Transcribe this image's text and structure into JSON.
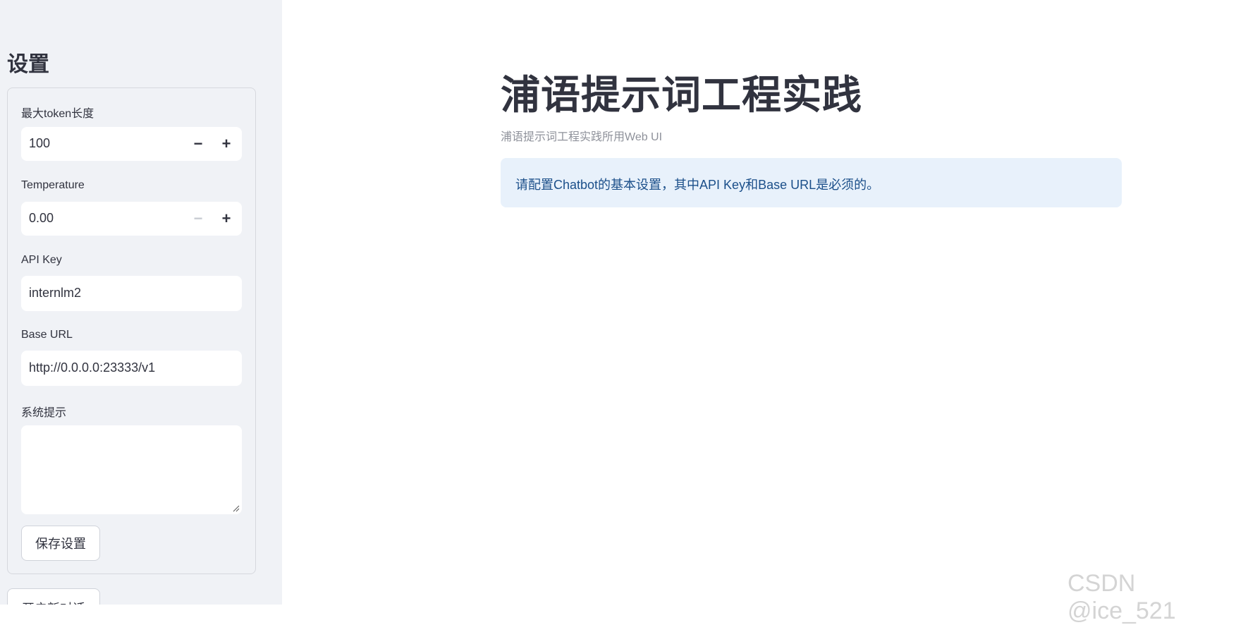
{
  "sidebar": {
    "title": "设置",
    "max_tokens": {
      "label": "最大token长度",
      "value": "100",
      "minus_icon": "minus-icon",
      "plus_icon": "plus-icon"
    },
    "temperature": {
      "label": "Temperature",
      "value": "0.00",
      "minus_icon": "minus-icon",
      "plus_icon": "plus-icon"
    },
    "api_key": {
      "label": "API Key",
      "value": "internlm2"
    },
    "base_url": {
      "label": "Base URL",
      "value": "http://0.0.0.0:23333/v1"
    },
    "system_prompt": {
      "label": "系统提示",
      "value": ""
    },
    "save_label": "保存设置",
    "new_chat_label": "开启新对话"
  },
  "main": {
    "title": "浦语提示词工程实践",
    "subtitle": "浦语提示词工程实践所用Web UI",
    "info_message": "请配置Chatbot的基本设置，其中API Key和Base URL是必须的。"
  },
  "watermark": "CSDN @ice_521",
  "colors": {
    "sidebar_bg": "#f0f2f6",
    "info_bg": "#e8f1fb",
    "info_text": "#1b4f8a",
    "text": "#31333f"
  }
}
